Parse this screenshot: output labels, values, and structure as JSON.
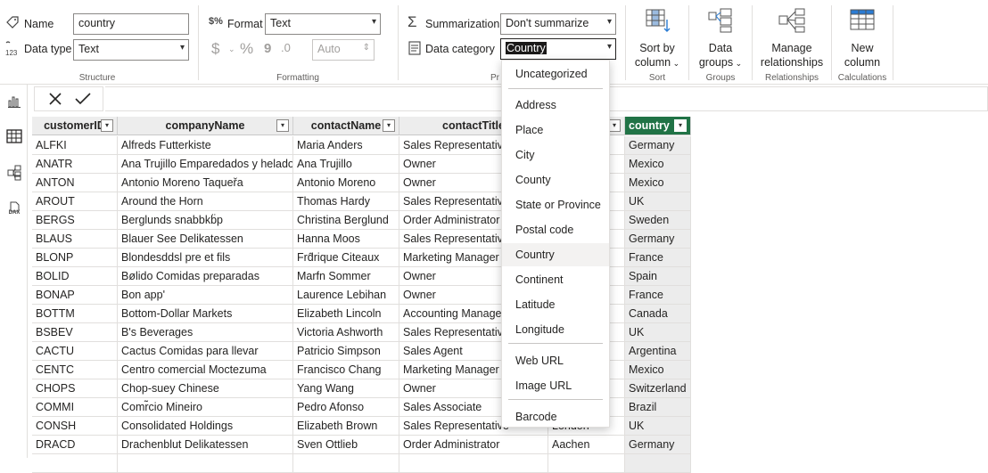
{
  "structure": {
    "name_label": "Name",
    "name_value": "country",
    "datatype_label": "Data type",
    "datatype_value": "Text",
    "group_label": "Structure"
  },
  "formatting": {
    "format_label": "Format",
    "format_value": "Text",
    "currency_symbol": "$",
    "percent_symbol": "%",
    "comma_symbol": "9",
    "decimal_value": "Auto",
    "group_label": "Formatting"
  },
  "properties": {
    "summarization_label": "Summarization",
    "summarization_value": "Don't summarize",
    "datacategory_label": "Data category",
    "datacategory_value": "Country",
    "group_label_partial": "Pr"
  },
  "sort": {
    "button_line1": "Sort by",
    "button_line2": "column",
    "group_label": "Sort"
  },
  "groups": {
    "button_line1": "Data",
    "button_line2": "groups",
    "group_label": "Groups"
  },
  "relationships": {
    "button_line1": "Manage",
    "button_line2": "relationships",
    "group_label": "Relationships"
  },
  "calculations": {
    "button_line1": "New",
    "button_line2": "column",
    "group_label": "Calculations"
  },
  "rail": {
    "dax_label": "DAX"
  },
  "data_category_menu": {
    "items": [
      "Uncategorized",
      "Address",
      "Place",
      "City",
      "County",
      "State or Province",
      "Postal code",
      "Country",
      "Continent",
      "Latitude",
      "Longitude",
      "Web URL",
      "Image URL",
      "Barcode"
    ],
    "selected": "Country"
  },
  "table": {
    "columns": [
      "customerID",
      "companyName",
      "contactName",
      "contactTitle",
      "",
      "country"
    ],
    "rows": [
      [
        "ALFKI",
        "Alfreds Futterkiste",
        "Maria Anders",
        "Sales Representative",
        "",
        "Germany"
      ],
      [
        "ANATR",
        "Ana Trujillo Emparedados y helados",
        "Ana Trujillo",
        "Owner",
        "",
        "Mexico"
      ],
      [
        "ANTON",
        "Antonio Moreno Taqueřa",
        "Antonio Moreno",
        "Owner",
        "",
        "Mexico"
      ],
      [
        "AROUT",
        "Around the Horn",
        "Thomas Hardy",
        "Sales Representative",
        "",
        "UK"
      ],
      [
        "BERGS",
        "Berglunds snabbkb̈p",
        "Christina Berglund",
        "Order Administrator",
        "",
        "Sweden"
      ],
      [
        "BLAUS",
        "Blauer See Delikatessen",
        "Hanna Moos",
        "Sales Representative",
        "",
        "Germany"
      ],
      [
        "BLONP",
        "Blondesddsl pre et fils",
        "Frd̂rique Citeaux",
        "Marketing Manager",
        "",
        "France"
      ],
      [
        "BOLID",
        "Bølido Comidas preparadas",
        "Marfn Sommer",
        "Owner",
        "",
        "Spain"
      ],
      [
        "BONAP",
        "Bon app'",
        "Laurence Lebihan",
        "Owner",
        "",
        "France"
      ],
      [
        "BOTTM",
        "Bottom-Dollar Markets",
        "Elizabeth Lincoln",
        "Accounting Manager",
        "",
        "Canada"
      ],
      [
        "BSBEV",
        "B's Beverages",
        "Victoria Ashworth",
        "Sales Representative",
        "",
        "UK"
      ],
      [
        "CACTU",
        "Cactus Comidas para llevar",
        "Patricio Simpson",
        "Sales Agent",
        "s",
        "Argentina"
      ],
      [
        "CENTC",
        "Centro comercial Moctezuma",
        "Francisco Chang",
        "Marketing Manager",
        "",
        "Mexico"
      ],
      [
        "CHOPS",
        "Chop-suey Chinese",
        "Yang Wang",
        "Owner",
        "",
        "Switzerland"
      ],
      [
        "COMMI",
        "Comr̃cio Mineiro",
        "Pedro Afonso",
        "Sales Associate",
        "",
        "Brazil"
      ],
      [
        "CONSH",
        "Consolidated Holdings",
        "Elizabeth Brown",
        "Sales Representative",
        "London",
        "UK"
      ],
      [
        "DRACD",
        "Drachenblut Delikatessen",
        "Sven Ottlieb",
        "Order Administrator",
        "Aachen",
        "Germany"
      ]
    ]
  }
}
